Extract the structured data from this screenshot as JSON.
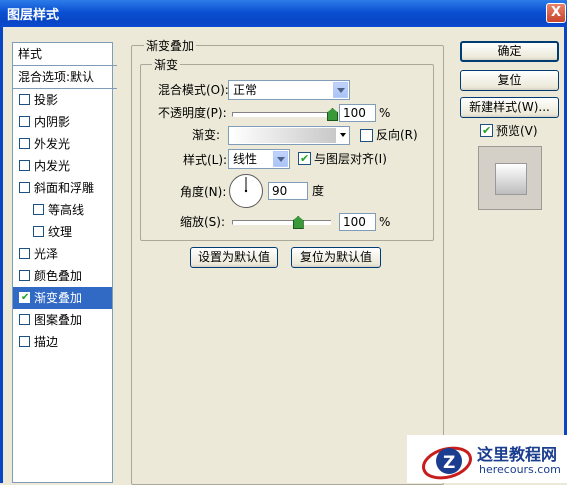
{
  "window": {
    "title": "图层样式",
    "close_glyph": "X"
  },
  "styles_panel": {
    "header": "样式",
    "blend_options": "混合选项:默认",
    "items": [
      {
        "label": "投影",
        "checked": false
      },
      {
        "label": "内阴影",
        "checked": false
      },
      {
        "label": "外发光",
        "checked": false
      },
      {
        "label": "内发光",
        "checked": false
      },
      {
        "label": "斜面和浮雕",
        "checked": false
      },
      {
        "label": "等高线",
        "checked": false
      },
      {
        "label": "纹理",
        "checked": false
      },
      {
        "label": "光泽",
        "checked": false
      },
      {
        "label": "颜色叠加",
        "checked": false
      },
      {
        "label": "渐变叠加",
        "checked": true
      },
      {
        "label": "图案叠加",
        "checked": false
      },
      {
        "label": "描边",
        "checked": false
      }
    ]
  },
  "gradient_overlay": {
    "group_title": "渐变叠加",
    "subgroup_title": "渐变",
    "blend_mode_label": "混合模式(O):",
    "blend_mode_value": "正常",
    "opacity_label": "不透明度(P):",
    "opacity_value": "100",
    "opacity_unit": "%",
    "gradient_label": "渐变:",
    "reverse_label": "反向(R)",
    "reverse_checked": false,
    "style_label": "样式(L):",
    "style_value": "线性",
    "align_label": "与图层对齐(I)",
    "align_checked": true,
    "angle_label": "角度(N):",
    "angle_value": "90",
    "angle_unit": "度",
    "scale_label": "缩放(S):",
    "scale_value": "100",
    "scale_unit": "%",
    "set_default_button": "设置为默认值",
    "reset_default_button": "复位为默认值",
    "opacity_level": 1.0,
    "scale_level": 0.67
  },
  "actions": {
    "ok": "确定",
    "reset": "复位",
    "new_style": "新建样式(W)...",
    "preview_label": "预览(V)",
    "preview_checked": true
  },
  "watermark": {
    "brand_text": "这里教程网",
    "url_text": "herecours.com"
  },
  "colors": {
    "title_bar": "#0846c6",
    "selection": "#316ac5",
    "dialog_bg": "#ece9d8"
  }
}
